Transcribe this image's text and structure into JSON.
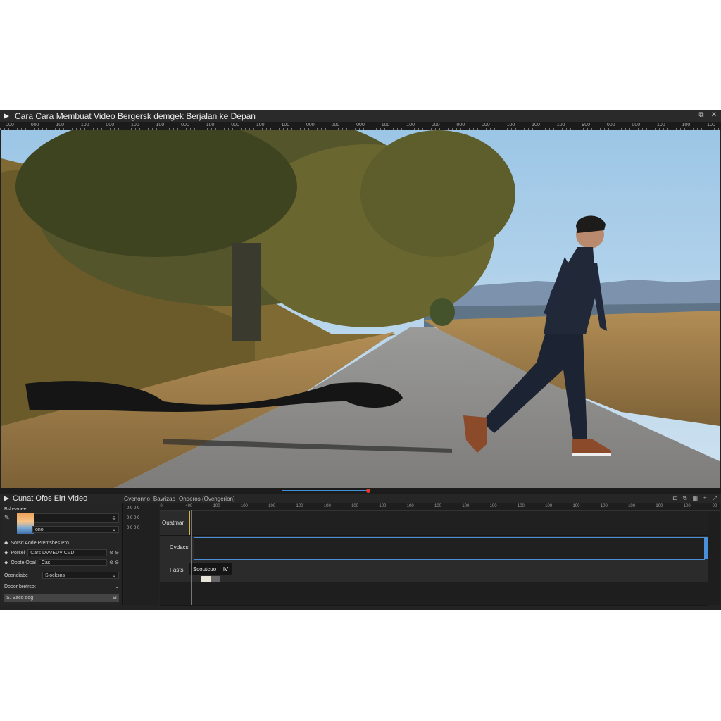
{
  "window": {
    "title": "Cara Cara Membuat Video Bergersk demgek Berjalan ke Depan",
    "controls": [
      "restore-icon",
      "close-icon"
    ]
  },
  "top_ruler": [
    "000",
    "000",
    "100",
    "100",
    "000",
    "100",
    "100",
    "000",
    "100",
    "000",
    "100",
    "100",
    "000",
    "000",
    "000",
    "100",
    "100",
    "000",
    "000",
    "000",
    "100",
    "100",
    "100",
    "900",
    "000",
    "000",
    "100",
    "100",
    "100"
  ],
  "editor": {
    "title": "Cunat Ofos Eirt Video",
    "tabs": [
      "Gvenonno",
      "Bavrizao",
      "Onderos (Ovengerion)"
    ],
    "tools": [
      "cut-icon",
      "copy-icon",
      "grid-icon",
      "crop-icon",
      "expand-icon"
    ]
  },
  "left_panel": {
    "header": "Bsbeanee",
    "field1_value": "ono",
    "rows": [
      {
        "label": "Sorsd Aode Premsbes Pro",
        "value": ""
      },
      {
        "label": "Porsel",
        "value": "Cars DVVEDV CVD"
      },
      {
        "label": "Ooote Ocal",
        "value": "Cas"
      }
    ],
    "dropdown1": {
      "label": "Oosndiabe",
      "value": "Siocksns"
    },
    "dropdown2": {
      "label": "Dooor bretrsot",
      "value": ""
    },
    "selected": "S. Saco oog"
  },
  "mid_panel": [
    "0 0 0 0",
    "0 0 0 0",
    "0 0 0 0"
  ],
  "timeline": {
    "ruler": [
      "0",
      "400",
      "100",
      "100",
      "100",
      "100",
      "100",
      "100",
      "100",
      "100",
      "100",
      "100",
      "100",
      "100",
      "100",
      "100",
      "100",
      "100",
      "100",
      "100",
      "00"
    ],
    "tracks": [
      {
        "name": "Ouatmar"
      },
      {
        "name": "Cvdacs"
      },
      {
        "name": "Fasts",
        "clip_label": "Scoutcuo"
      }
    ]
  },
  "colors": {
    "accent": "#3d8fd8",
    "playhead_knob": "#e23b2e",
    "selection_border": "#4a90d9",
    "clip_edge": "#d7b24a"
  }
}
